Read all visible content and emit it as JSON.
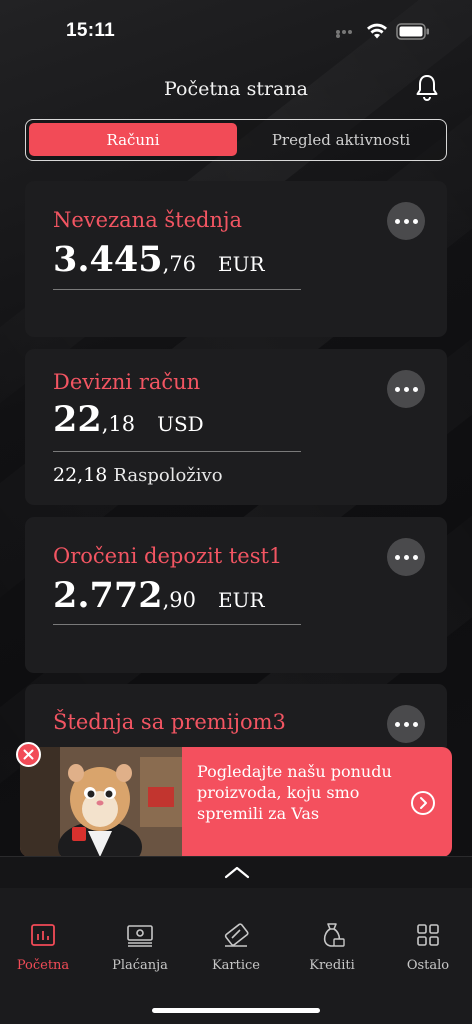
{
  "status_bar": {
    "time": "15:11"
  },
  "header": {
    "title": "Početna strana"
  },
  "segment": {
    "active": "Računi",
    "inactive": "Pregled aktivnosti"
  },
  "accounts": [
    {
      "name": "Nevezana štednja",
      "amount_int": "3.445",
      "amount_dec": ",76",
      "currency": "EUR"
    },
    {
      "name": "Devizni račun",
      "amount_int": "22",
      "amount_dec": ",18",
      "currency": "USD",
      "available_value": "22,18",
      "available_label": "Raspoloživo"
    },
    {
      "name": "Oročeni depozit test1",
      "amount_int": "2.772",
      "amount_dec": ",90",
      "currency": "EUR"
    },
    {
      "name": "Štednja sa premijom3"
    }
  ],
  "promo": {
    "text": "Pogledajte našu ponudu proizvoda, koju smo spremili  za Vas"
  },
  "tabs": [
    {
      "label": "Početna",
      "icon": "chart-icon",
      "active": true
    },
    {
      "label": "Plaćanja",
      "icon": "payments-icon"
    },
    {
      "label": "Kartice",
      "icon": "card-icon"
    },
    {
      "label": "Krediti",
      "icon": "money-bag-icon"
    },
    {
      "label": "Ostalo",
      "icon": "grid-icon"
    }
  ],
  "colors": {
    "accent": "#f24b57",
    "card": "#1d1d1f",
    "background": "#0e0e10"
  }
}
